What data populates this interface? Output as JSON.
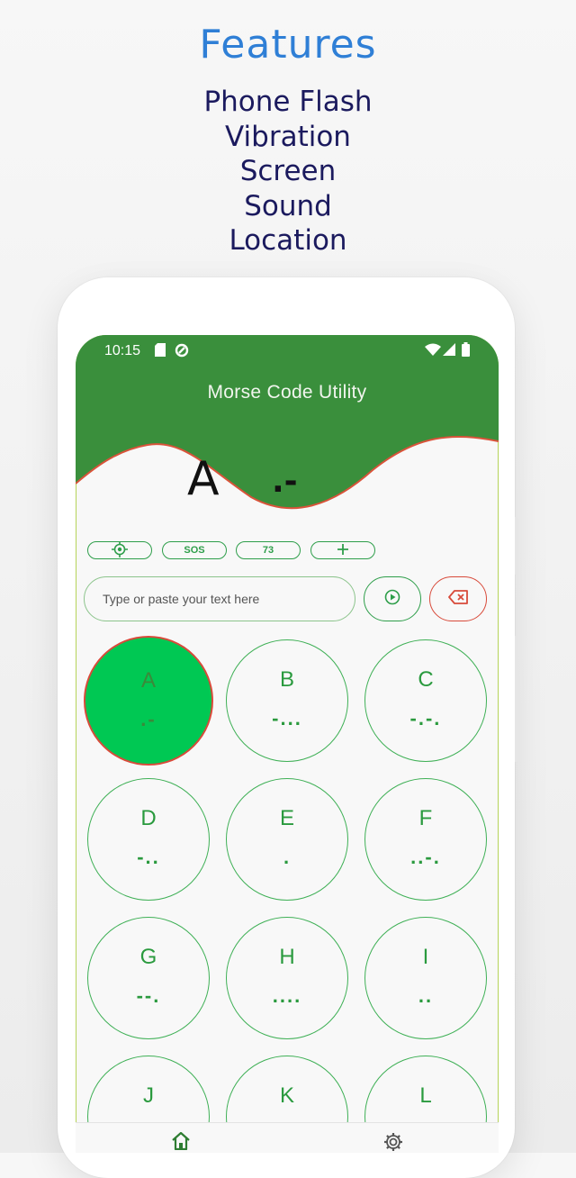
{
  "promo": {
    "title": "Features",
    "features": [
      "Phone Flash",
      "Vibration",
      "Screen",
      "Sound",
      "Location"
    ]
  },
  "status_bar": {
    "time": "10:15",
    "icons": [
      "sd-card-icon",
      "sync-icon",
      "wifi-icon",
      "signal-icon",
      "battery-icon"
    ]
  },
  "app": {
    "title": "Morse Code Utility",
    "current_letter": "A",
    "current_code": ".-"
  },
  "quick_actions": {
    "location_icon": "crosshair-icon",
    "sos_label": "SOS",
    "seventy_three_label": "73",
    "add_icon": "plus-icon"
  },
  "input": {
    "placeholder": "Type or paste your text here",
    "play_icon": "play-icon",
    "clear_icon": "backspace-icon"
  },
  "keys": [
    {
      "letter": "A",
      "code": ".-",
      "selected": true
    },
    {
      "letter": "B",
      "code": "-...",
      "selected": false
    },
    {
      "letter": "C",
      "code": "-.-.",
      "selected": false
    },
    {
      "letter": "D",
      "code": "-..",
      "selected": false
    },
    {
      "letter": "E",
      "code": ".",
      "selected": false
    },
    {
      "letter": "F",
      "code": "..-.",
      "selected": false
    },
    {
      "letter": "G",
      "code": "--.",
      "selected": false
    },
    {
      "letter": "H",
      "code": "....",
      "selected": false
    },
    {
      "letter": "I",
      "code": "..",
      "selected": false
    },
    {
      "letter": "J",
      "code": "",
      "selected": false
    },
    {
      "letter": "K",
      "code": "",
      "selected": false
    },
    {
      "letter": "L",
      "code": "",
      "selected": false
    }
  ],
  "bottom_nav": {
    "items": [
      {
        "icon": "home-icon"
      },
      {
        "icon": "gear-icon"
      }
    ]
  },
  "colors": {
    "header_green": "#3a8f3c",
    "wave_edge": "#d9533a",
    "accent_green": "#2e9e4a",
    "selected_key": "#00c853",
    "danger": "#d84a3a",
    "title_blue": "#2f7fd6",
    "feature_navy": "#1b1a5e"
  }
}
